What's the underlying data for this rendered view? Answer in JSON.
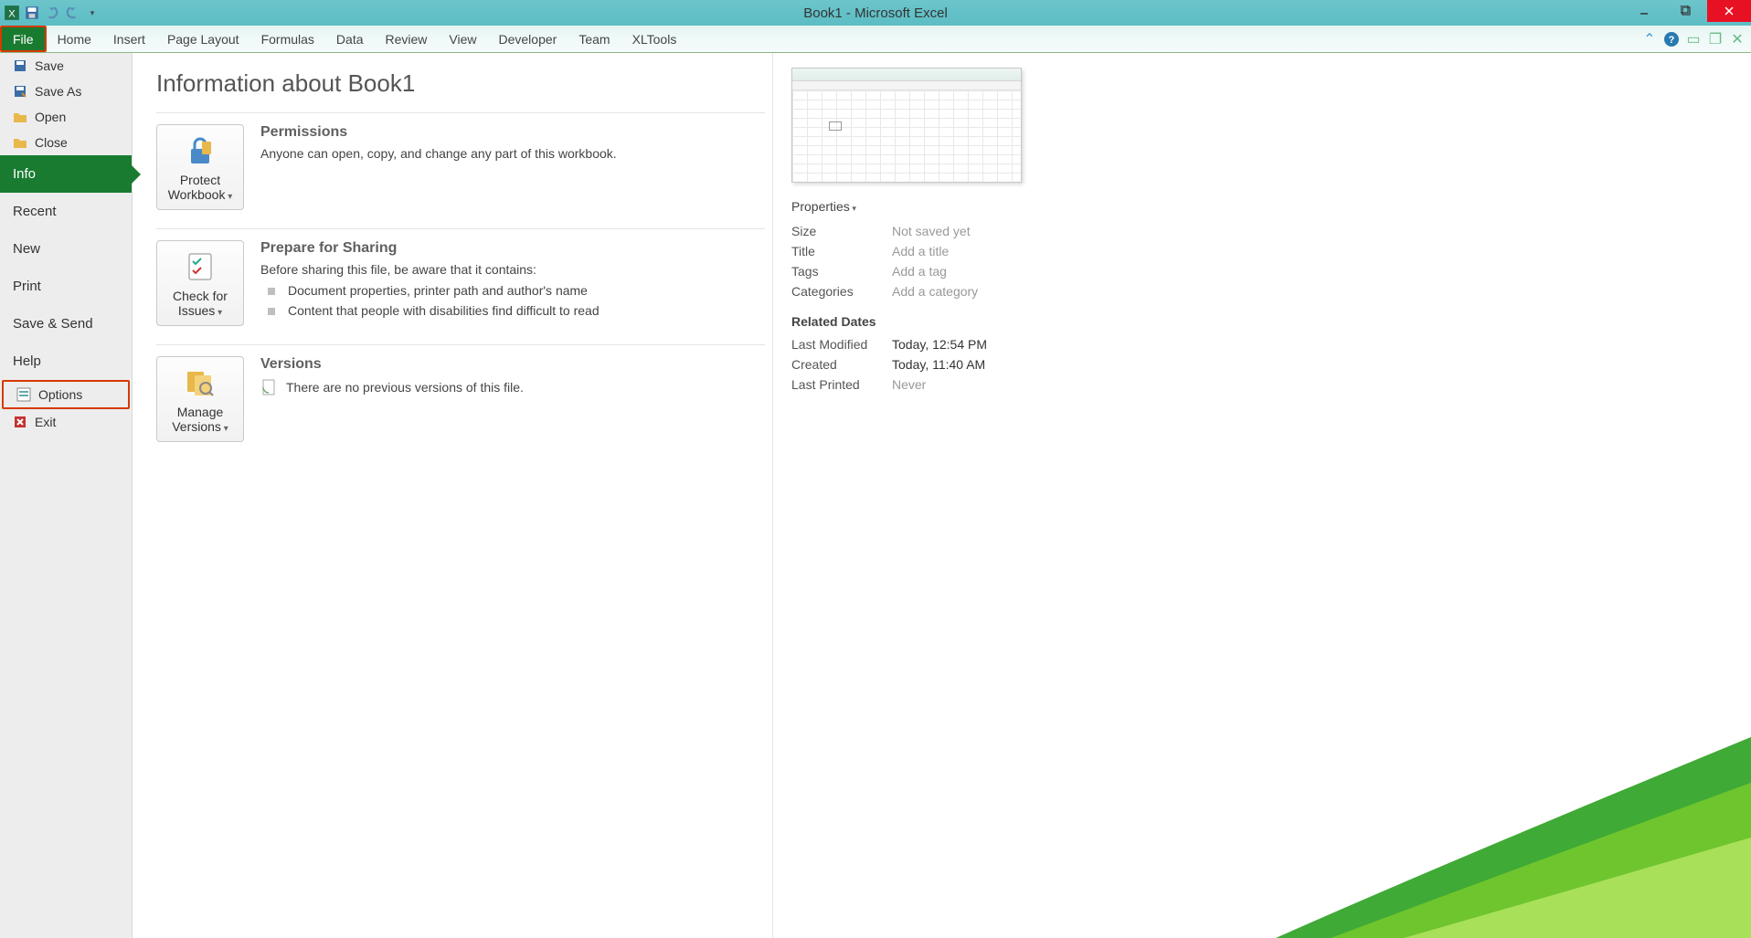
{
  "title": "Book1 - Microsoft Excel",
  "ribbon_tabs": [
    "File",
    "Home",
    "Insert",
    "Page Layout",
    "Formulas",
    "Data",
    "Review",
    "View",
    "Developer",
    "Team",
    "XLTools"
  ],
  "sidebar": {
    "save": "Save",
    "save_as": "Save As",
    "open": "Open",
    "close": "Close",
    "info": "Info",
    "recent": "Recent",
    "new": "New",
    "print": "Print",
    "save_send": "Save & Send",
    "help": "Help",
    "options": "Options",
    "exit": "Exit"
  },
  "info": {
    "heading": "Information about Book1",
    "permissions": {
      "title": "Permissions",
      "desc": "Anyone can open, copy, and change any part of this workbook.",
      "button_line1": "Protect",
      "button_line2": "Workbook"
    },
    "prepare": {
      "title": "Prepare for Sharing",
      "desc": "Before sharing this file, be aware that it contains:",
      "items": [
        "Document properties, printer path and author's name",
        "Content that people with disabilities find difficult to read"
      ],
      "button_line1": "Check for",
      "button_line2": "Issues"
    },
    "versions": {
      "title": "Versions",
      "desc": "There are no previous versions of this file.",
      "button_line1": "Manage",
      "button_line2": "Versions"
    }
  },
  "properties": {
    "header": "Properties",
    "rows": [
      {
        "label": "Size",
        "value": "Not saved yet",
        "dim": true
      },
      {
        "label": "Title",
        "value": "Add a title",
        "dim": true
      },
      {
        "label": "Tags",
        "value": "Add a tag",
        "dim": true
      },
      {
        "label": "Categories",
        "value": "Add a category",
        "dim": true
      }
    ],
    "related_header": "Related Dates",
    "related": [
      {
        "label": "Last Modified",
        "value": "Today, 12:54 PM",
        "dim": false
      },
      {
        "label": "Created",
        "value": "Today, 11:40 AM",
        "dim": false
      },
      {
        "label": "Last Printed",
        "value": "Never",
        "dim": true
      }
    ]
  }
}
